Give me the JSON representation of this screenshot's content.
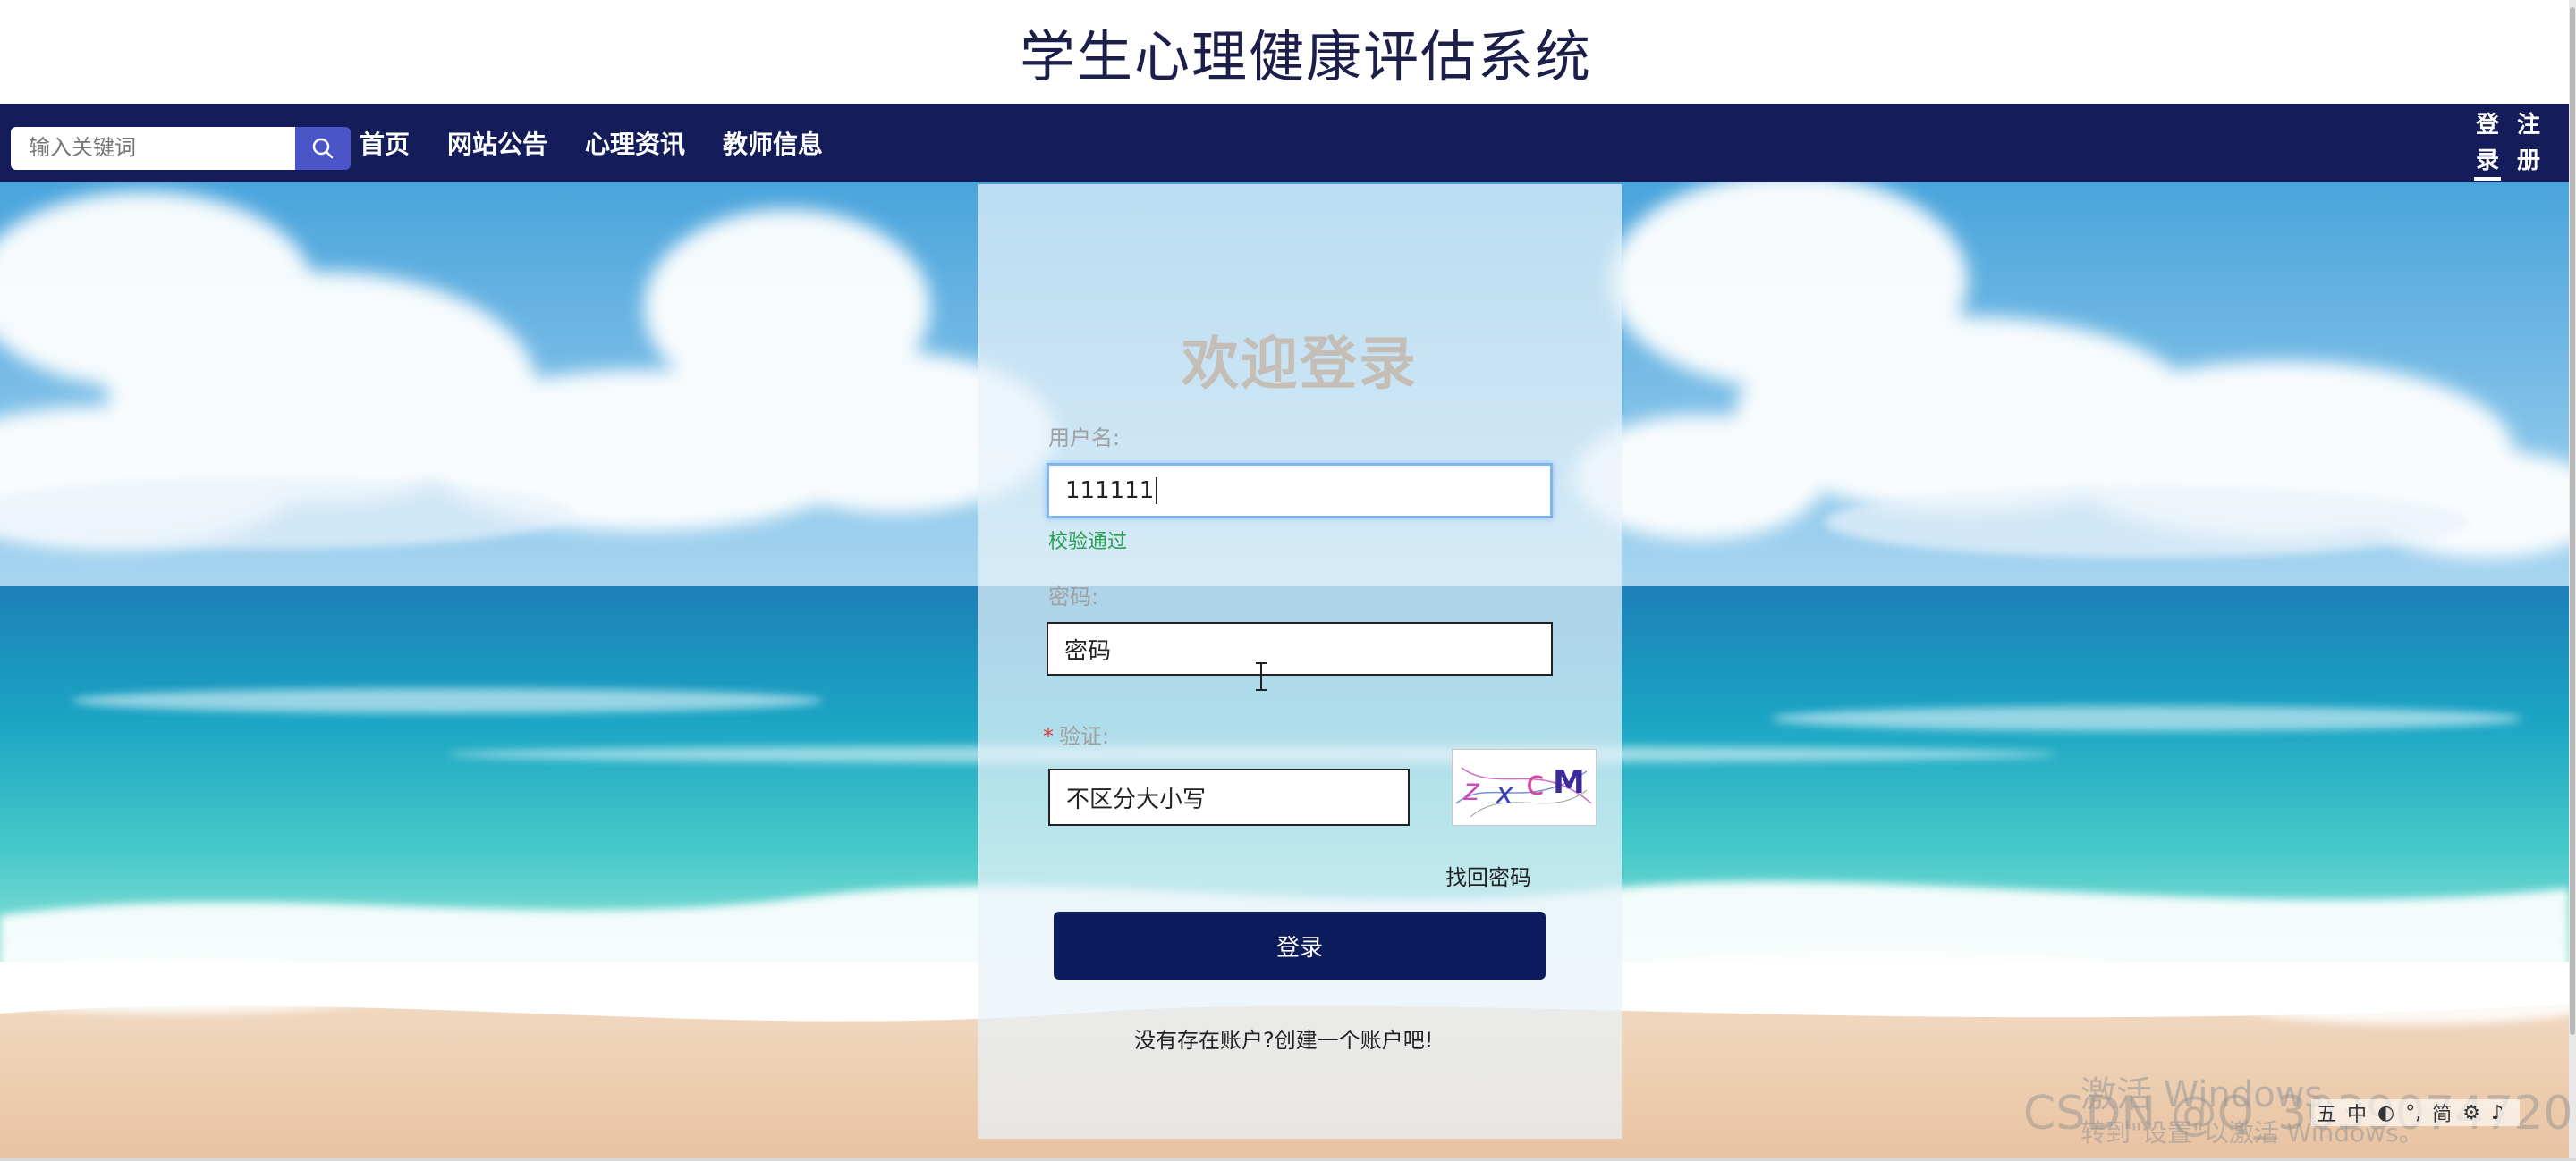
{
  "header": {
    "title": "学生心理健康评估系统"
  },
  "nav": {
    "search_placeholder": "输入关键词",
    "items": [
      "首页",
      "网站公告",
      "心理资讯",
      "教师信息"
    ],
    "login": [
      "登",
      "录"
    ],
    "register": [
      "注",
      "册"
    ]
  },
  "login_form": {
    "title": "欢迎登录",
    "username_label": "用户名:",
    "username_value": "111111",
    "username_valid_msg": "校验通过",
    "password_label": "密码:",
    "password_placeholder": "密码",
    "captcha_required_mark": "*",
    "captcha_label": "验证:",
    "captcha_placeholder": "不区分大小写",
    "captcha_text": "zxcM",
    "forgot_link": "找回密码",
    "submit_label": "登录",
    "signup_link": "没有存在账户?创建一个账户吧!"
  },
  "overlay": {
    "activate_windows": "激活 Windows",
    "activate_hint": "转到\"设置\"以激活 Windows。",
    "csdn_watermark": "CSDN @Q_3039074720",
    "ime_items": [
      "五",
      "中",
      "◐",
      "°,",
      "简",
      "⚙",
      "♪"
    ]
  },
  "colors": {
    "navbar": "#141d59",
    "search_button": "#4a56c8",
    "login_button": "#0d1c5c",
    "valid": "#2aa052"
  }
}
